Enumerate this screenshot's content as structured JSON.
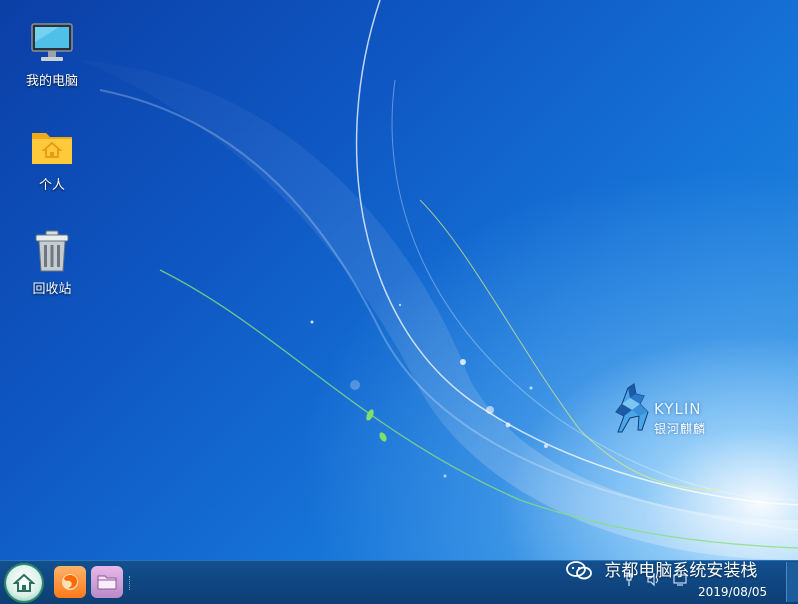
{
  "desktop": {
    "icons": [
      {
        "label": "我的电脑",
        "icon": "computer-icon"
      },
      {
        "label": "个人",
        "icon": "home-folder-icon"
      },
      {
        "label": "回收站",
        "icon": "trash-icon"
      }
    ],
    "logo": {
      "brand_en": "KYLIN",
      "brand_cn": "银河麒麟"
    }
  },
  "taskbar": {
    "launchers": [
      {
        "name": "start-menu",
        "icon": "home-icon"
      },
      {
        "name": "firefox",
        "icon": "firefox-icon"
      },
      {
        "name": "file-manager",
        "icon": "folder-icon"
      }
    ],
    "watermark": "京都电脑系统安装栈",
    "date": "2019/08/05"
  },
  "colors": {
    "taskbar": "#0f4680",
    "desktop_deep": "#0b3fa6",
    "desktop_light": "#2a92e4"
  }
}
